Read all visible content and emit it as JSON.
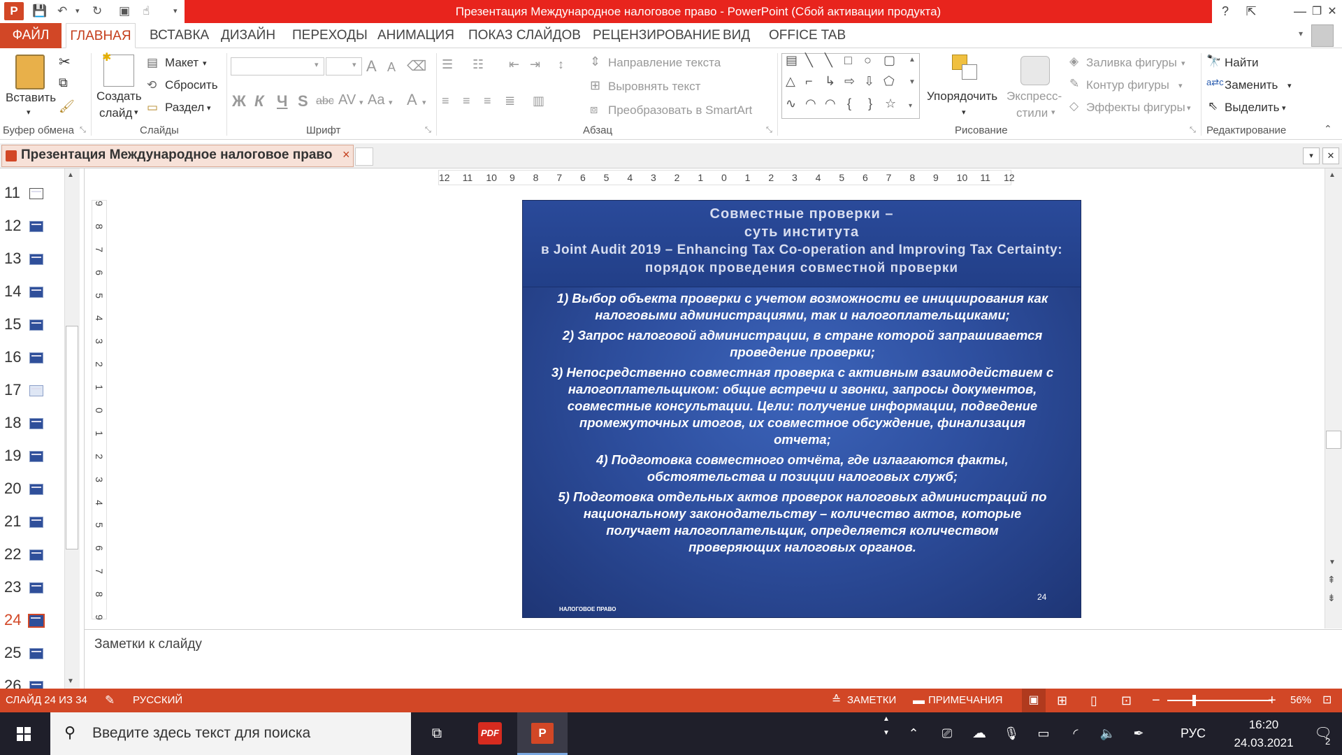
{
  "window": {
    "title": "Презентация Международное налоговое право  -  PowerPoint (Сбой активации продукта)",
    "help": "?",
    "minimize": "—",
    "restore": "❐",
    "close": "✕"
  },
  "tabs": [
    {
      "label": "ФАЙЛ"
    },
    {
      "label": "ГЛАВНАЯ"
    },
    {
      "label": "ВСТАВКА"
    },
    {
      "label": "ДИЗАЙН"
    },
    {
      "label": "ПЕРЕХОДЫ"
    },
    {
      "label": "АНИМАЦИЯ"
    },
    {
      "label": "ПОКАЗ СЛАЙДОВ"
    },
    {
      "label": "РЕЦЕНЗИРОВАНИЕ"
    },
    {
      "label": "ВИД"
    },
    {
      "label": "OFFICE TAB"
    }
  ],
  "ribbon": {
    "clipboard": {
      "paste": "Вставить",
      "group": "Буфер обмена"
    },
    "slides": {
      "new_slide_1": "Создать",
      "new_slide_2": "слайд",
      "layout": "Макет",
      "reset": "Сбросить",
      "section": "Раздел",
      "group": "Слайды"
    },
    "font": {
      "bold": "Ж",
      "italic": "К",
      "underline": "Ч",
      "shadow": "S",
      "strike": "abc",
      "spacing": "AV",
      "case": "Aa",
      "color": "A",
      "grow": "A",
      "shrink": "A",
      "group": "Шрифт"
    },
    "paragraph": {
      "direction": "Направление текста",
      "align": "Выровнять текст",
      "smartart": "Преобразовать в SmartArt",
      "group": "Абзац"
    },
    "drawing": {
      "arrange": "Упорядочить",
      "quick_1": "Экспресс-",
      "quick_2": "стили",
      "fill": "Заливка фигуры",
      "outline": "Контур фигуры",
      "effects": "Эффекты фигуры",
      "group": "Рисование"
    },
    "editing": {
      "find": "Найти",
      "replace": "Заменить",
      "select": "Выделить",
      "group": "Редактирование"
    }
  },
  "doc_tab": {
    "label": "Презентация Международное налоговое право",
    "close": "×"
  },
  "thumbnails": [
    "11",
    "12",
    "13",
    "14",
    "15",
    "16",
    "17",
    "18",
    "19",
    "20",
    "21",
    "22",
    "23",
    "24",
    "25",
    "26"
  ],
  "active_slide": "24",
  "ruler": {
    "h": [
      "12",
      "11",
      "10",
      "9",
      "8",
      "7",
      "6",
      "5",
      "4",
      "3",
      "2",
      "1",
      "0",
      "1",
      "2",
      "3",
      "4",
      "5",
      "6",
      "7",
      "8",
      "9",
      "10",
      "11",
      "12"
    ],
    "v": [
      "9",
      "8",
      "7",
      "6",
      "5",
      "4",
      "3",
      "2",
      "1",
      "0",
      "1",
      "2",
      "3",
      "4",
      "5",
      "6",
      "7",
      "8",
      "9"
    ]
  },
  "slide": {
    "title_1": "Совместные проверки –",
    "title_2": "суть института",
    "title_3": "в Joint Audit 2019 – Enhancing Tax Co-operation and Improving Tax Certainty:",
    "title_4": "порядок проведения совместной проверки",
    "p1a": "1)  Выбор объекта проверки с учетом возможности ее инициирования как",
    "p1b": "налоговыми администрациями, так и налогоплательщиками;",
    "p2a": "2)  Запрос налоговой администрации, в стране которой запрашивается",
    "p2b": "проведение проверки;",
    "p3a": "3)  Непосредственно совместная проверка с активным взаимодействием с",
    "p3b": "налогоплательщиком: общие встречи и звонки, запросы документов,",
    "p3c": "совместные консультации. Цели: получение информации, подведение",
    "p3d": "промежуточных итогов, их совместное обсуждение, финализация",
    "p3e": "отчета;",
    "p4a": "4)  Подготовка совместного отчёта, где излагаются факты,",
    "p4b": "обстоятельства и позиции налоговых служб;",
    "p5a": "5)  Подготовка отдельных актов проверок налоговых администраций по",
    "p5b": "национальному законодательству – количество актов, которые",
    "p5c": "получает налогоплательщик, определяется количеством",
    "p5d": "проверяющих налоговых органов.",
    "footer": "НАЛОГОВОЕ ПРАВО",
    "page": "24"
  },
  "notes": {
    "placeholder": "Заметки к слайду"
  },
  "status": {
    "slide": "СЛАЙД 24 ИЗ 34",
    "lang": "РУССКИЙ",
    "notes": "ЗАМЕТКИ",
    "comments": "ПРИМЕЧАНИЯ",
    "zoom": "56%",
    "zoom_level": 0.56
  },
  "taskbar": {
    "search": "Введите здесь текст для поиска",
    "pdf": "PDF",
    "lang": "РУС",
    "time": "16:20",
    "date": "24.03.2021",
    "notif": "2"
  },
  "colors": {
    "accent": "#d24726",
    "title_red": "#e8241d",
    "slide_bg": "#2e4f9f"
  }
}
